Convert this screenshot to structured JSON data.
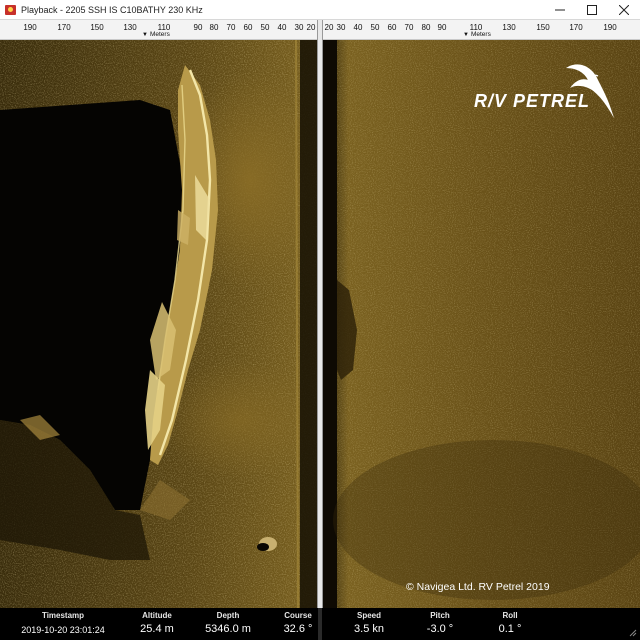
{
  "window": {
    "title": "Playback - 2205 SSH IS C10BATHY 230 KHz",
    "controls": {
      "minimize": "minimize-icon",
      "maximize": "maximize-icon",
      "close": "close-icon"
    }
  },
  "ruler": {
    "unit": "Meters",
    "left_ticks": [
      "190",
      "170",
      "150",
      "130",
      "110",
      "90",
      "80",
      "70",
      "60",
      "50",
      "40",
      "30",
      "20"
    ],
    "right_ticks": [
      "20",
      "30",
      "40",
      "50",
      "60",
      "70",
      "80",
      "90",
      "110",
      "130",
      "150",
      "170",
      "190"
    ]
  },
  "overlay": {
    "logo_text": "R/V PETREL",
    "logo_icon": "seabird-icon",
    "copyright": "© Navigea Ltd. RV Petrel 2019"
  },
  "status": {
    "timestamp": {
      "label": "Timestamp",
      "value": "2019-10-20 23:01:24"
    },
    "altitude": {
      "label": "Altitude",
      "value": "25.4 m"
    },
    "depth": {
      "label": "Depth",
      "value": "5346.0 m"
    },
    "course": {
      "label": "Course",
      "value": "32.6 °"
    },
    "speed": {
      "label": "Speed",
      "value": "3.5 kn"
    },
    "pitch": {
      "label": "Pitch",
      "value": "-3.0 °"
    },
    "roll": {
      "label": "Roll",
      "value": "0.1 °"
    }
  },
  "colors": {
    "sonar_base": "#6b5418",
    "sonar_bright": "#e8d890",
    "sonar_shadow": "#0a0703"
  }
}
